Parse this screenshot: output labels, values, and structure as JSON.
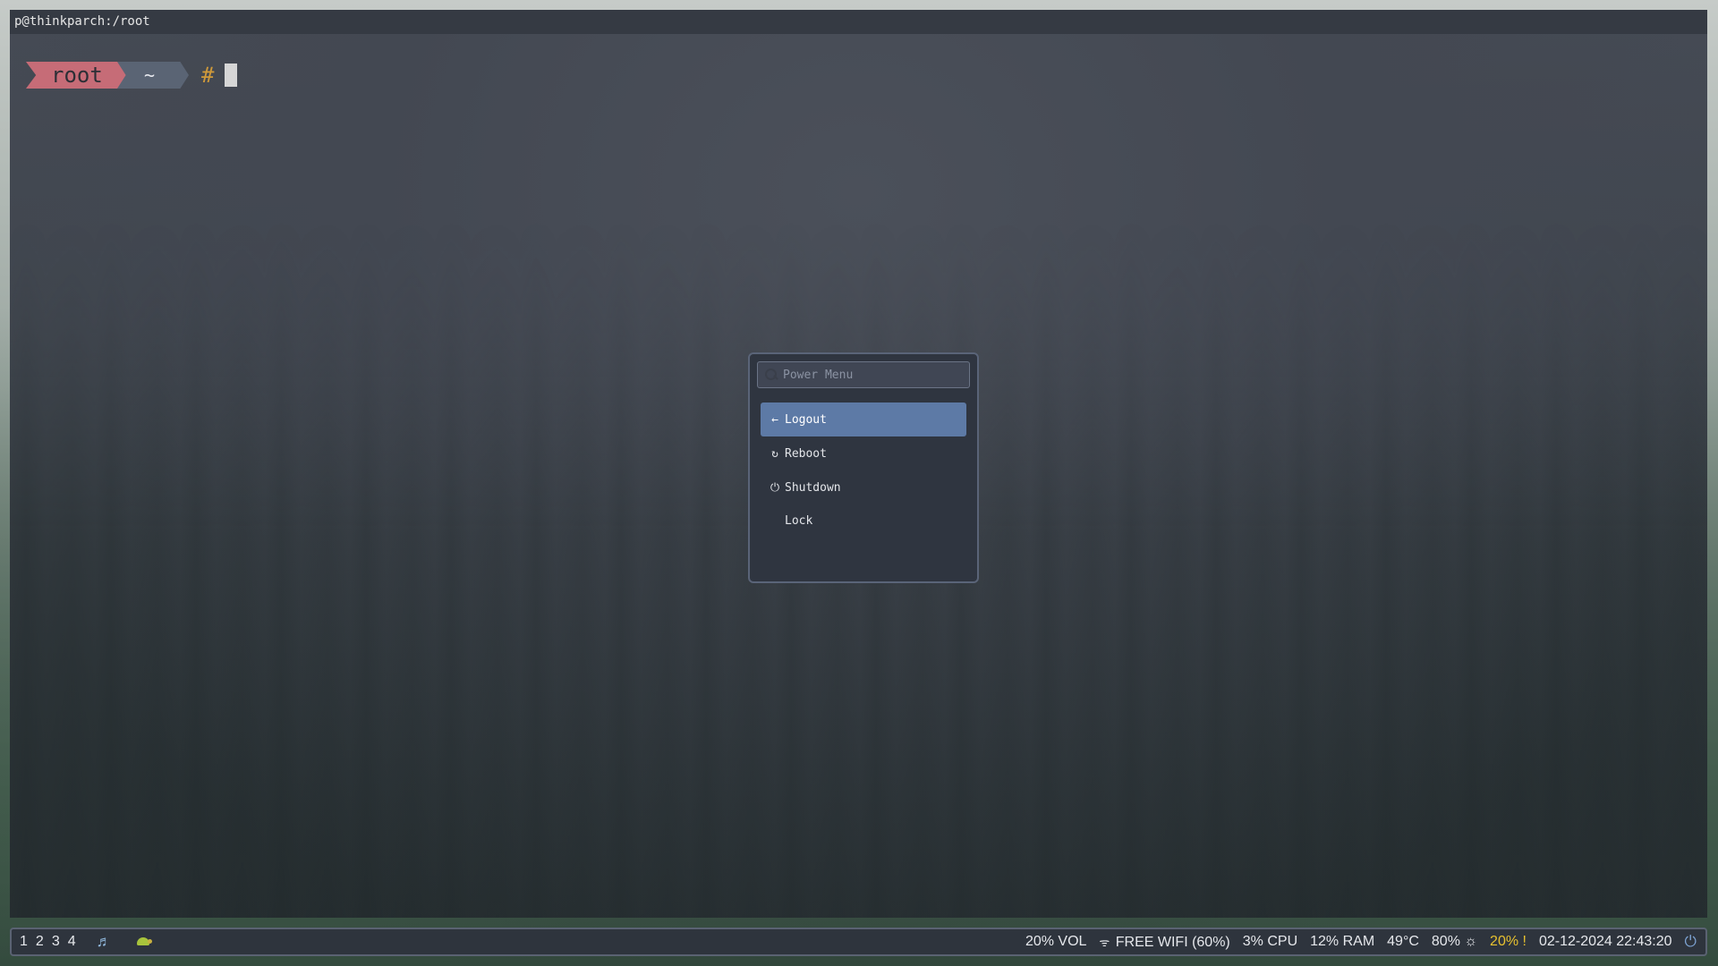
{
  "terminal": {
    "title": "p@thinkparch:/root",
    "prompt_user": "root",
    "prompt_dir": "~",
    "prompt_symbol": "#"
  },
  "power_menu": {
    "placeholder": "Power Menu",
    "items": [
      {
        "icon": "←",
        "label": "Logout",
        "selected": true
      },
      {
        "icon": "↻",
        "label": "Reboot",
        "selected": false
      },
      {
        "icon": "⏻",
        "label": "Shutdown",
        "selected": false
      },
      {
        "icon": "",
        "label": "Lock",
        "selected": false
      }
    ]
  },
  "statusbar": {
    "workspaces": [
      "1",
      "2",
      "3",
      "4"
    ],
    "volume": "20% VOL",
    "wifi": "FREE WIFI (60%)",
    "cpu": "3% CPU",
    "ram": "12% RAM",
    "temp": "49°C",
    "brightness": "80% ☼",
    "battery": "20% !",
    "datetime": "02-12-2024 22:43:20"
  },
  "colors": {
    "selected": "#5d7aa6",
    "prompt_root": "#c66c77",
    "warning": "#e8c230"
  }
}
